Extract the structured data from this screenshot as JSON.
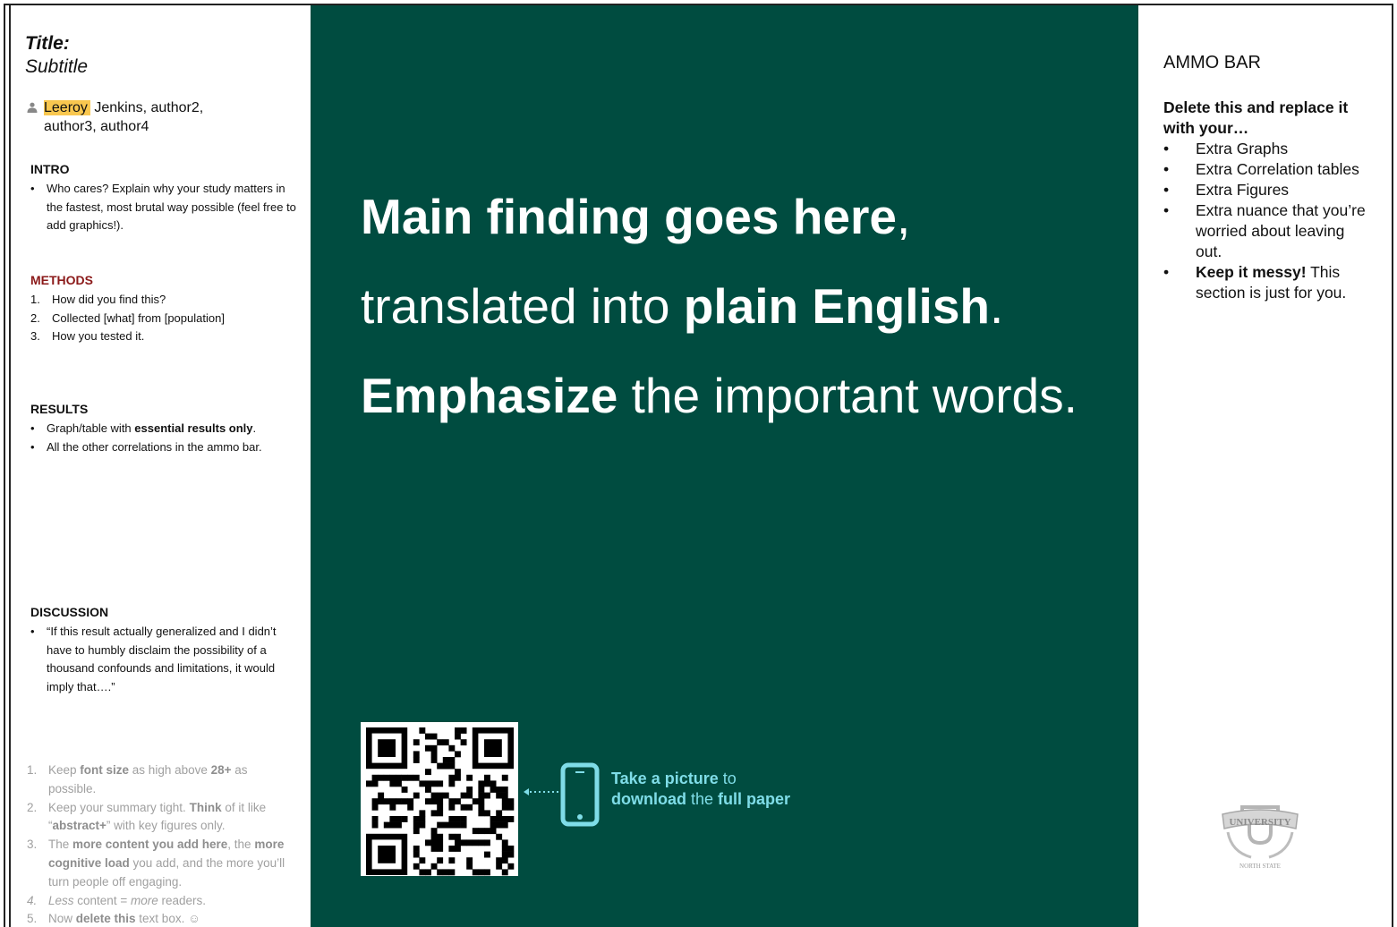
{
  "left": {
    "title": "Title:",
    "subtitle": "Subtitle",
    "author_highlight": "Leeroy",
    "author_rest": " Jenkins, author2,",
    "author_line2": "author3, author4",
    "intro": {
      "heading": "INTRO",
      "bullets": [
        "Who cares? Explain why your study matters in the fastest, most brutal way possible (feel free to add graphics!)."
      ]
    },
    "methods": {
      "heading": "METHODS",
      "items": [
        {
          "num": "1.",
          "text": "How did you find this?"
        },
        {
          "num": "2.",
          "text": "Collected [what] from [population]"
        },
        {
          "num": "3.",
          "text": "How you tested it."
        }
      ]
    },
    "results": {
      "heading": "RESULTS",
      "b1_pre": "Graph/table with ",
      "b1_bold": "essential results only",
      "b1_post": ".",
      "b2": "All the other correlations in the ammo bar."
    },
    "discussion": {
      "heading": "DISCUSSION",
      "bullet": "“If this result actually generalized and I didn’t have to humbly disclaim the possibility of a thousand confounds and limitations, it would imply that….”"
    },
    "tips": {
      "t1_num": "1.",
      "t1_a": "Keep ",
      "t1_b": "font size",
      "t1_c": " as high above ",
      "t1_d": "28+",
      "t1_e": " as possible.",
      "t2_num": "2.",
      "t2_a": "Keep your summary tight. ",
      "t2_b": "Think",
      "t2_c": " of it like “",
      "t2_d": "abstract+",
      "t2_e": "” with key figures only.",
      "t3_num": "3.",
      "t3_a": "The ",
      "t3_b": "more content you add here",
      "t3_c": ", the ",
      "t3_d": "more cognitive load",
      "t3_e": " you add, and the more you’ll turn people off engaging.",
      "t4_num": "4.",
      "t4_a": "Less",
      "t4_b": " content = ",
      "t4_c": "more",
      "t4_d": " readers.",
      "t5_num": "5.",
      "t5_a": "Now ",
      "t5_b": "delete this",
      "t5_c": " text box. ☺"
    }
  },
  "center": {
    "line1_bold": "Main finding goes here",
    "line1_rest": ",",
    "line2_a": "translated into ",
    "line2_bold": "plain English",
    "line2_end": ".",
    "line3_bold": "Emphasize",
    "line3_rest": " the important words.",
    "cta_bold1": "Take a picture",
    "cta_mid": " to",
    "cta_bold2": "download",
    "cta_the": " the ",
    "cta_bold3": "full paper",
    "accent_color": "#7fdde8",
    "bg_color": "#004c40"
  },
  "right": {
    "title": "AMMO BAR",
    "intro": "Delete this and replace it with your…",
    "items": [
      "Extra Graphs",
      "Extra Correlation tables",
      "Extra Figures",
      "Extra nuance that you’re worried about leaving out."
    ],
    "last_bold": "Keep it messy!",
    "last_rest": " This section is just for you.",
    "logo_text": "UNIVERSITY",
    "logo_sub": "NORTH STATE"
  }
}
